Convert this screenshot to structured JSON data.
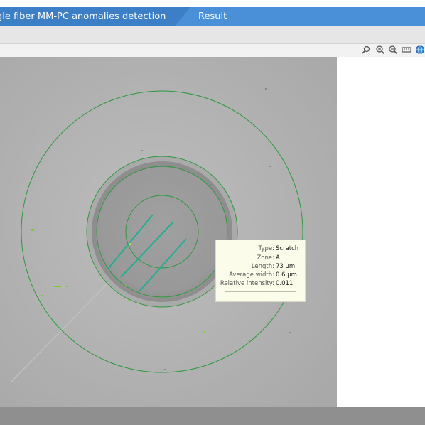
{
  "header": {
    "tabs": [
      {
        "label": "gle fiber MM-PC anomalies detection",
        "active": true
      },
      {
        "label": "Result",
        "active": false
      }
    ],
    "accent_color": "#4a90d9"
  },
  "toolbar": {
    "icons": [
      "zoom-reset-icon",
      "zoom-in-icon",
      "zoom-out-icon",
      "ruler-icon",
      "globe-icon"
    ]
  },
  "tooltip": {
    "rows": [
      {
        "label": "Type:",
        "value": "Scratch"
      },
      {
        "label": "Zone:",
        "value": "A"
      },
      {
        "label": "Length:",
        "value": "73 µm"
      },
      {
        "label": "Average width:",
        "value": "0.6 µm"
      },
      {
        "label": "Relative intensity:",
        "value": "0.011"
      }
    ]
  },
  "colors": {
    "zone_circle": "#2a9a3a",
    "scratch": "#20b090",
    "defect": "#7acc2a"
  }
}
